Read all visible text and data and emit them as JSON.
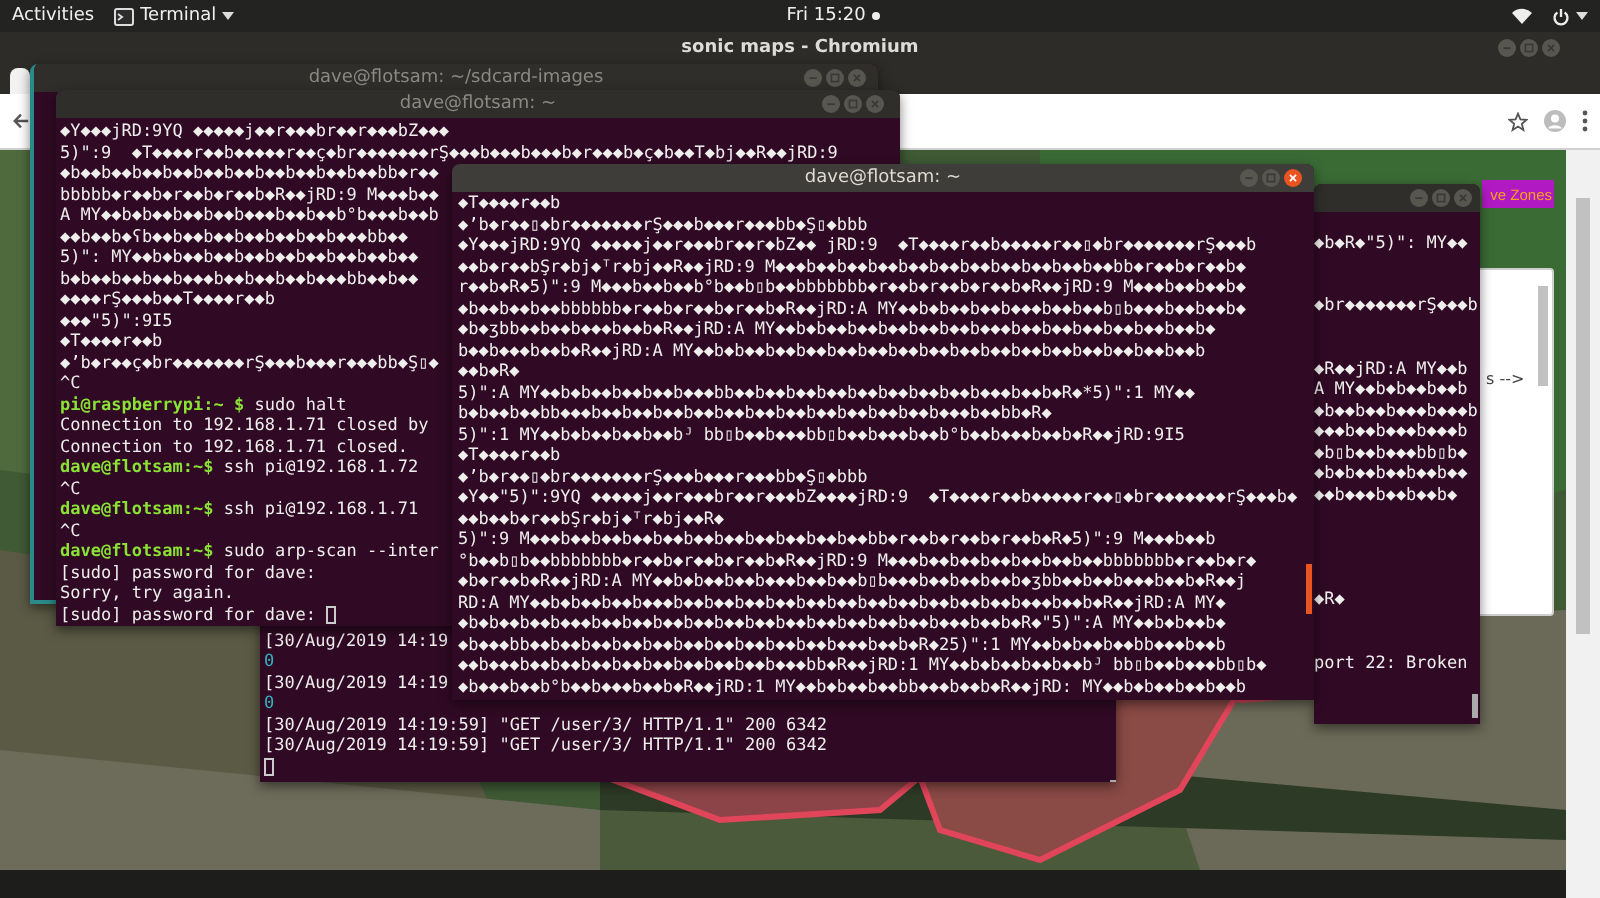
{
  "top_bar": {
    "activities": "Activities",
    "app_menu": "Terminal",
    "clock": "Fri 15:20"
  },
  "browser": {
    "title": "sonic maps - Chromium",
    "map_button": "ve Zones",
    "side_panel_text": "s -->"
  },
  "terminal_images": {
    "title": "dave@flotsam: ~/sdcard-images",
    "active": false
  },
  "terminal_log": {
    "lines": [
      {
        "kind": "output",
        "text": "[30/Aug/2019 14:19"
      },
      {
        "kind": "status",
        "text": "0"
      },
      {
        "kind": "output",
        "text": "[30/Aug/2019 14:19"
      },
      {
        "kind": "status",
        "text": "0"
      },
      {
        "kind": "output",
        "text": "[30/Aug/2019 14:19:59] \"GET /user/3/ HTTP/1.1\" 200 6342"
      },
      {
        "kind": "output",
        "text": "[30/Aug/2019 14:19:59] \"GET /user/3/ HTTP/1.1\" 200 6342"
      },
      {
        "kind": "cursor"
      }
    ]
  },
  "terminal_home": {
    "title": "dave@flotsam: ~",
    "active": false,
    "lines": [
      {
        "kind": "output",
        "text": "◆Y◆◆◆jRD:9YQ ◆◆◆◆◆j◆◆r◆◆◆br◆◆r◆◆◆bZ◆◆◆"
      },
      {
        "kind": "output",
        "text": "5)\":9  ◆T◆◆◆◆r◆◆b◆◆◆◆◆r◆◆ç◆br◆◆◆◆◆◆◆rŞ◆◆◆b◆◆◆b◆◆◆b◆r◆◆◆b◆ç◆b◆◆T◆bj◆◆R◆◆jRD:9"
      },
      {
        "kind": "output",
        "text": "◆b◆◆b◆◆b◆◆b◆◆b◆◆b◆◆b◆◆b◆◆b◆◆b◆◆bb◆r◆◆"
      },
      {
        "kind": "output",
        "text": "bbbbb◆r◆◆b◆r◆◆b◆r◆◆b◆R◆◆jRD:9 M◆◆◆b◆◆"
      },
      {
        "kind": "output",
        "text": "A MY◆◆b◆b◆◆b◆◆b◆◆b◆◆◆b◆◆b◆◆b°b◆◆◆b◆◆b"
      },
      {
        "kind": "output",
        "text": "◆◆b◆◆b◆ʕb◆◆b◆◆b◆◆b◆◆b◆◆b◆◆b◆◆◆bb◆◆"
      },
      {
        "kind": "output",
        "text": "5)\": MY◆◆b◆b◆◆b◆◆b◆◆b◆◆b◆◆b◆◆b◆◆b◆◆"
      },
      {
        "kind": "output",
        "text": "b◆b◆◆b◆◆b◆◆b◆◆◆b◆◆b◆◆b◆◆b◆◆◆bb◆◆b◆◆"
      },
      {
        "kind": "output",
        "text": "◆◆◆◆rŞ◆◆◆b◆◆T◆◆◆◆r◆◆b"
      },
      {
        "kind": "output",
        "text": "◆◆◆\"5)\":9I5"
      },
      {
        "kind": "output",
        "text": "◆T◆◆◆◆r◆◆b"
      },
      {
        "kind": "output",
        "text": "◆ʼb◆r◆◆ç◆br◆◆◆◆◆◆◆rŞ◆◆◆b◆◆◆r◆◆◆bb◆Ş▯◆"
      },
      {
        "kind": "output",
        "text": "^C"
      },
      {
        "kind": "command",
        "prompt": "pi@raspberrypi:~ $",
        "text": " sudo halt"
      },
      {
        "kind": "output",
        "text": "Connection to 192.168.1.71 closed by"
      },
      {
        "kind": "output",
        "text": "Connection to 192.168.1.71 closed."
      },
      {
        "kind": "command",
        "prompt": "dave@flotsam:~$",
        "text": " ssh pi@192.168.1.72"
      },
      {
        "kind": "output",
        "text": "^C"
      },
      {
        "kind": "command",
        "prompt": "dave@flotsam:~$",
        "text": " ssh pi@192.168.1.71"
      },
      {
        "kind": "output",
        "text": "^C"
      },
      {
        "kind": "command",
        "prompt": "dave@flotsam:~$",
        "text": " sudo arp-scan --inter"
      },
      {
        "kind": "output",
        "text": "[sudo] password for dave:"
      },
      {
        "kind": "output",
        "text": "Sorry, try again."
      },
      {
        "kind": "input",
        "text": "[sudo] password for dave: "
      }
    ]
  },
  "terminal_side": {
    "active": false,
    "lines": [
      {
        "kind": "blank"
      },
      {
        "kind": "output",
        "text": "◆b◆R◆\"5)\": MY◆◆"
      },
      {
        "kind": "blank"
      },
      {
        "kind": "blank"
      },
      {
        "kind": "output",
        "text": "◆br◆◆◆◆◆◆◆rŞ◆◆◆b"
      },
      {
        "kind": "blank"
      },
      {
        "kind": "blank"
      },
      {
        "kind": "output",
        "text": "◆R◆◆jRD:A MY◆◆b"
      },
      {
        "kind": "output",
        "text": "A MY◆◆b◆b◆◆b◆◆b"
      },
      {
        "kind": "output",
        "text": "◆b◆◆b◆◆b◆◆◆b◆◆◆b"
      },
      {
        "kind": "output",
        "text": "◆◆◆b◆◆b◆◆◆b◆◆◆b"
      },
      {
        "kind": "output",
        "text": "◆b▯b◆◆b◆◆◆bb▯b◆"
      },
      {
        "kind": "output",
        "text": "◆b◆b◆◆b◆◆b◆◆b◆◆"
      },
      {
        "kind": "output",
        "text": "◆◆b◆◆◆b◆◆b◆◆b◆"
      },
      {
        "kind": "blank"
      },
      {
        "kind": "blank"
      },
      {
        "kind": "blank"
      },
      {
        "kind": "blank"
      },
      {
        "kind": "output",
        "text": "◆R◆"
      },
      {
        "kind": "blank"
      },
      {
        "kind": "blank"
      },
      {
        "kind": "output",
        "text": "port 22: Broken"
      }
    ]
  },
  "terminal_front": {
    "title": "dave@flotsam: ~",
    "active": true,
    "lines": [
      {
        "kind": "output",
        "text": "◆T◆◆◆◆r◆◆b"
      },
      {
        "kind": "output",
        "text": "◆ʼb◆r◆◆▯◆br◆◆◆◆◆◆◆rŞ◆◆◆b◆◆◆r◆◆◆bb◆Ş▯◆bbb"
      },
      {
        "kind": "output",
        "text": "◆Y◆◆◆jRD:9YQ ◆◆◆◆◆j◆◆r◆◆◆br◆◆r◆bZ◆◆ jRD:9  ◆T◆◆◆◆r◆◆b◆◆◆◆◆r◆◆▯◆br◆◆◆◆◆◆◆rŞ◆◆◆b"
      },
      {
        "kind": "output",
        "text": "◆◆b◆r◆◆bŞr◆bj◆ᵀr◆bj◆◆R◆◆jRD:9 M◆◆◆b◆◆b◆◆b◆◆b◆◆b◆◆b◆◆b◆◆b◆◆b◆◆b◆◆bb◆r◆◆b◆r◆◆b◆"
      },
      {
        "kind": "output",
        "text": "r◆◆b◆R◆5)\":9 M◆◆◆b◆◆b◆◆b°b◆◆b▯b◆◆bbbbbbb◆r◆◆b◆r◆◆b◆r◆◆b◆R◆◆jRD:9 M◆◆◆b◆◆b◆◆b◆"
      },
      {
        "kind": "output",
        "text": "◆b◆◆b◆◆b◆◆bbbbbb◆r◆◆b◆r◆◆b◆r◆◆b◆R◆◆jRD:A MY◆◆b◆b◆◆b◆◆b◆◆◆b◆◆b◆◆b▯b◆◆◆b◆◆b◆◆b◆"
      },
      {
        "kind": "output",
        "text": "◆b◆ʒbb◆◆b◆◆b◆◆◆b◆◆b◆R◆◆jRD:A MY◆◆b◆b◆◆b◆◆b◆◆b◆◆b◆◆b◆◆◆b◆◆b◆◆b◆◆b◆◆b◆◆b◆◆b◆"
      },
      {
        "kind": "output",
        "text": "b◆◆b◆◆◆b◆◆b◆R◆◆jRD:A MY◆◆b◆b◆◆b◆◆b◆◆b◆◆b◆◆b◆◆b◆◆b◆◆b◆◆b◆◆b◆◆b◆◆b◆◆b◆◆b◆◆b"
      },
      {
        "kind": "output",
        "text": "◆◆b◆R◆"
      },
      {
        "kind": "output",
        "text": "5)\":A MY◆◆b◆b◆◆b◆◆b◆◆b◆◆◆bb◆◆b◆◆b◆◆b◆◆b◆◆b◆◆b◆◆b◆◆b◆◆◆b◆◆b◆R◆*5)\":1 MY◆◆"
      },
      {
        "kind": "output",
        "text": "b◆b◆◆b◆◆bb◆◆◆b◆◆b◆◆b◆◆b◆◆b◆◆b◆◆b◆◆b◆◆b◆◆b◆◆b◆◆b◆◆◆b◆◆bb◆R◆"
      },
      {
        "kind": "output",
        "text": "5)\":1 MY◆◆b◆b◆◆b◆◆b◆◆bᴶ bb▯b◆◆b◆◆◆bb▯b◆◆b◆◆◆b◆◆b°b◆◆b◆◆◆b◆◆b◆R◆◆jRD:9I5"
      },
      {
        "kind": "output",
        "text": "◆T◆◆◆◆r◆◆b"
      },
      {
        "kind": "output",
        "text": "◆ʼb◆r◆◆▯◆br◆◆◆◆◆◆◆rŞ◆◆◆b◆◆◆r◆◆◆bb◆Ş▯◆bbb"
      },
      {
        "kind": "output",
        "text": "◆Y◆◆\"5)\":9YQ ◆◆◆◆◆j◆◆r◆◆◆br◆◆r◆◆◆bZ◆◆◆◆jRD:9  ◆T◆◆◆◆r◆◆b◆◆◆◆◆r◆◆▯◆br◆◆◆◆◆◆◆rŞ◆◆◆b◆"
      },
      {
        "kind": "output",
        "text": "◆◆b◆◆b◆r◆◆bŞr◆bj◆ᵀr◆bj◆◆R◆"
      },
      {
        "kind": "output",
        "text": "5)\":9 M◆◆◆b◆◆b◆◆b◆◆b◆◆b◆◆b◆◆b◆◆b◆◆b◆◆b◆◆bb◆r◆◆b◆r◆◆b◆r◆◆b◆R◆5)\":9 M◆◆◆b◆◆b"
      },
      {
        "kind": "output",
        "text": "°b◆◆b▯b◆◆bbbbbbb◆r◆◆b◆r◆◆b◆r◆◆b◆R◆◆jRD:9 M◆◆◆b◆◆b◆◆b◆◆b◆◆b◆◆b◆◆bbbbbbb◆r◆◆b◆r◆"
      },
      {
        "kind": "output",
        "text": "◆b◆r◆◆b◆R◆◆jRD:A MY◆◆b◆b◆◆b◆◆b◆◆◆b◆◆b◆◆b▯b◆◆◆b◆◆b◆◆b◆◆b◆ʒbb◆◆b◆◆b◆◆◆b◆◆b◆R◆◆j"
      },
      {
        "kind": "output",
        "text": "RD:A MY◆◆b◆b◆◆b◆◆b◆◆◆b◆◆b◆◆b◆◆b◆◆b◆◆b◆◆b◆◆b◆◆b◆◆b◆◆b◆◆b◆◆◆b◆◆b◆R◆◆jRD:A MY◆"
      },
      {
        "kind": "output",
        "text": "◆b◆b◆◆b◆◆b◆◆◆b◆◆b◆◆b◆◆b◆◆b◆◆b◆◆b◆◆b◆◆b◆◆b◆◆b◆◆b◆◆◆b◆◆b◆R◆\"5)\":A MY◆◆b◆b◆◆b◆"
      },
      {
        "kind": "output",
        "text": "◆b◆◆◆bb◆◆b◆◆b◆◆b◆◆b◆◆b◆◆b◆◆b◆◆b◆◆b◆◆b◆◆◆b◆◆b◆R◆25)\":1 MY◆◆b◆b◆◆b◆◆bb◆◆◆b◆◆b"
      },
      {
        "kind": "output",
        "text": "◆◆b◆◆◆b◆◆b◆◆b◆◆b◆◆b◆◆b◆◆b◆◆b◆◆b◆◆◆bb◆R◆◆jRD:1 MY◆◆b◆b◆◆b◆◆b◆◆bᴶ bb▯b◆◆b◆◆◆bb▯b◆"
      },
      {
        "kind": "output",
        "text": "◆b◆◆◆b◆◆b°b◆◆b◆◆◆b◆◆b◆R◆◆jRD:1 MY◆◆b◆b◆◆b◆◆bb◆◆◆b◆◆b◆R◆◆jRD: MY◆◆b◆b◆◆b◆◆b◆◆b"
      }
    ]
  }
}
